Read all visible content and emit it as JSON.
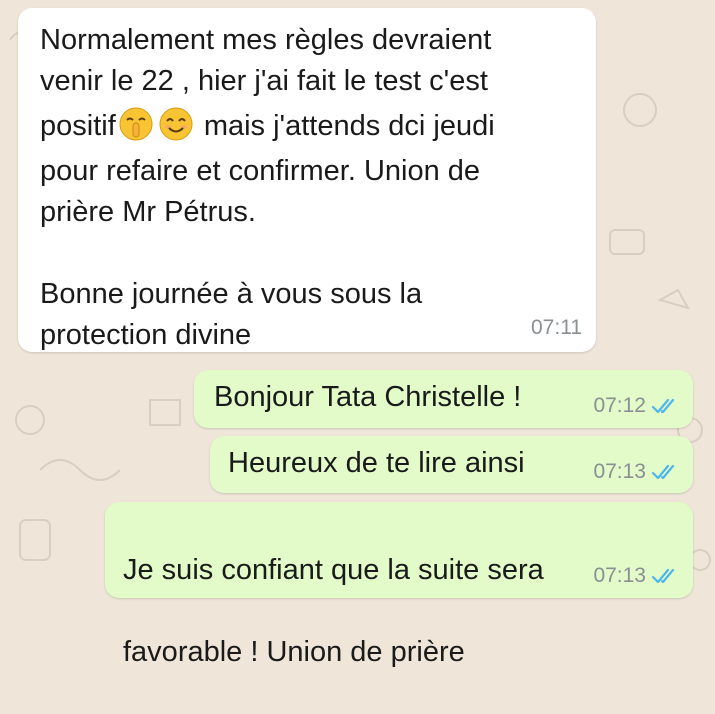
{
  "chat": {
    "messages": [
      {
        "direction": "incoming",
        "line1": "Normalement mes règles devraient",
        "line2": "venir le 22 , hier j'ai fait le test c'est",
        "line3_before_emoji": "positif",
        "emojis": [
          "shushing-face-icon",
          "smiling-face-icon"
        ],
        "line3_after_emoji": " mais j'attends dci jeudi",
        "line4": "pour refaire et confirmer. Union de",
        "line5": "prière Mr Pétrus.",
        "line6": "Bonne journée à vous sous la",
        "line7": "protection divine",
        "time": "07:11"
      },
      {
        "direction": "outgoing",
        "text": "Bonjour Tata Christelle !",
        "time": "07:12",
        "status": "read"
      },
      {
        "direction": "outgoing",
        "text": "Heureux de te lire ainsi",
        "time": "07:13",
        "status": "read"
      },
      {
        "direction": "outgoing",
        "line1": "Je suis confiant que la suite sera",
        "line2": "favorable ! Union de prière",
        "time": "07:13",
        "status": "read"
      }
    ]
  },
  "colors": {
    "wallpaper": "#efe6d9",
    "incoming_bubble": "#ffffff",
    "outgoing_bubble": "#e2fbc9",
    "read_ticks": "#4fb6ec",
    "timestamp": "#8a8f94"
  }
}
